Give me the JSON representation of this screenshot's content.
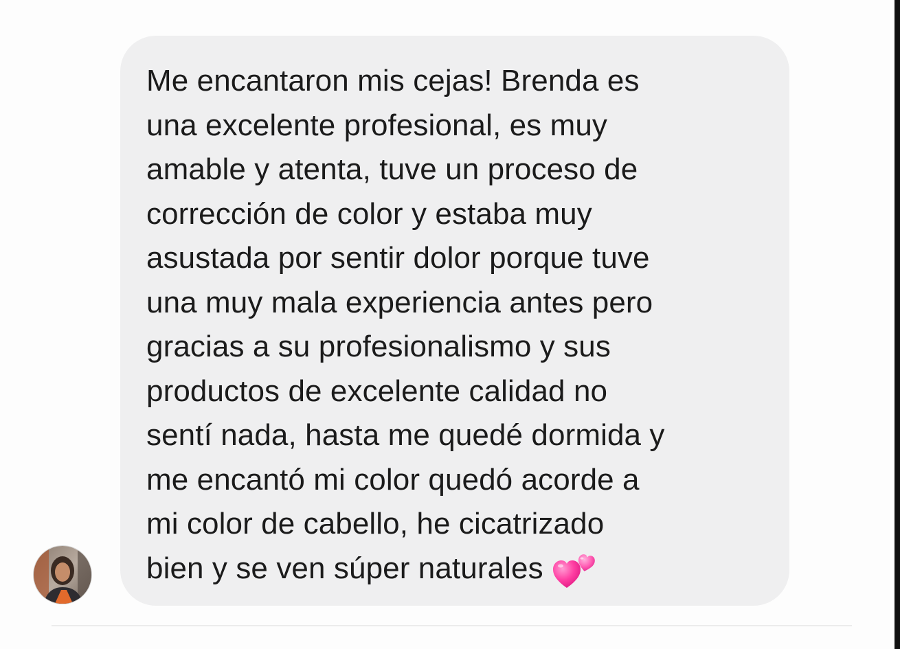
{
  "conversation": {
    "message": {
      "text": "Me encantaron mis cejas! Brenda es\nuna excelente profesional, es muy\namable y atenta, tuve un proceso de\ncorrección de color y estaba muy\nasustada por sentir dolor porque tuve\nuna muy mala experiencia antes pero\ngracias a su profesionalismo y sus\nproductos de excelente calidad no\nsentí nada, hasta me quedé dormida y\nme encantó mi color quedó acorde a\nmi color de cabello, he cicatrizado\nbien y se ven súper naturales",
      "emoji": "two-hearts-icon",
      "bubble_color": "#efeff0",
      "text_color": "#1b1b1b"
    },
    "sender": {
      "avatar_icon": "user-avatar-photo"
    }
  },
  "colors": {
    "background": "#fdfdfd",
    "emoji_pink": "#ff3fa3"
  }
}
